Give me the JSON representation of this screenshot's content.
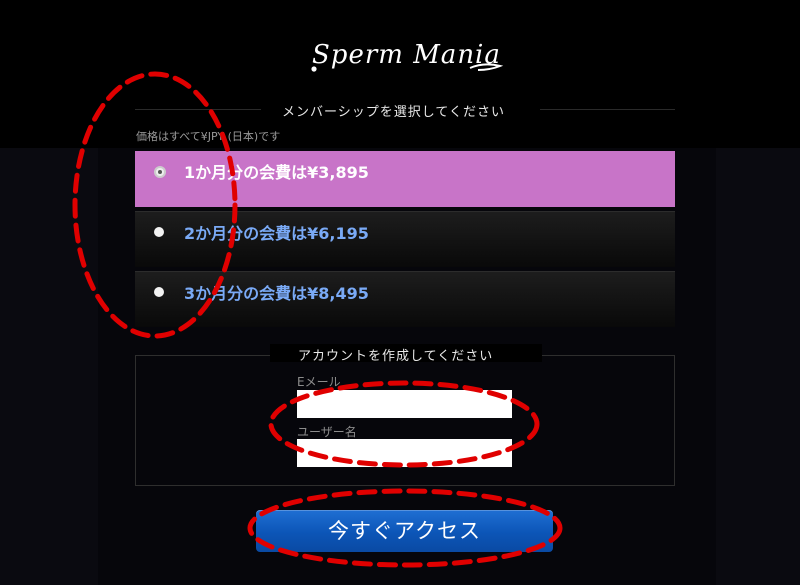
{
  "logo": {
    "text": "Sperm Mania"
  },
  "membership": {
    "title": "メンバーシップを選択してください",
    "price_note": "価格はすべて¥JPY (日本)です",
    "plans": [
      {
        "label": "1か月分の会費は¥3,895",
        "selected": true
      },
      {
        "label": "2か月分の会費は¥6,195",
        "selected": false
      },
      {
        "label": "3か月分の会費は¥8,495",
        "selected": false
      }
    ]
  },
  "account": {
    "title": "アカウントを作成してください",
    "email_label": "Eメール",
    "email_value": "",
    "username_label": "ユーザー名",
    "username_value": ""
  },
  "cta": {
    "label": "今すぐアクセス"
  },
  "colors": {
    "selected_plan_bg": "#c874c8",
    "plan_label_blue": "#7aaaf6",
    "cta_blue": "#0c55b7",
    "annotation_red": "#e00000"
  }
}
